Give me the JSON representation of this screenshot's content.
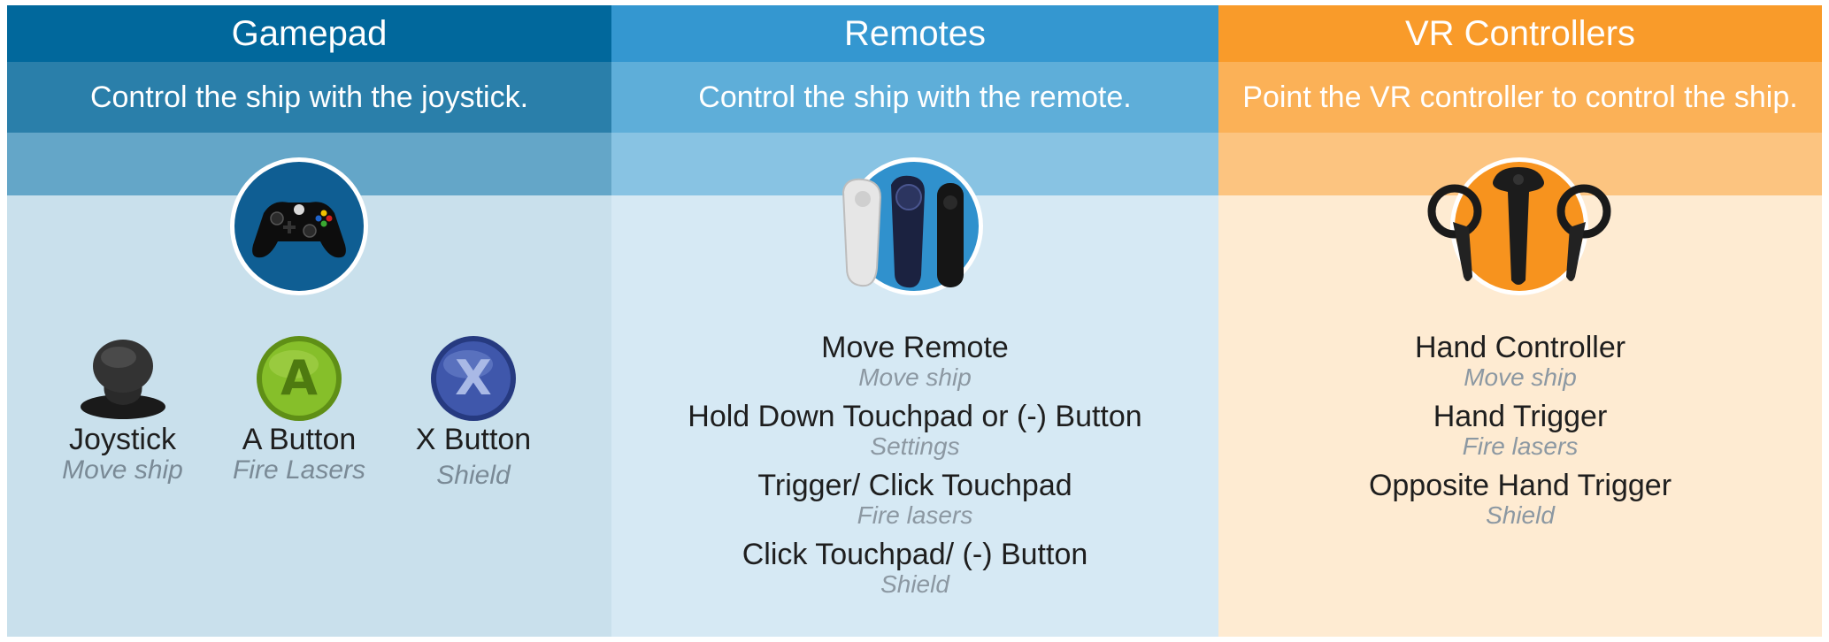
{
  "gamepad": {
    "title": "Gamepad",
    "subtitle": "Control the ship with the joystick.",
    "hero_icon": "xbox-controller-icon",
    "buttons": [
      {
        "name": "Joystick",
        "desc": "Move ship",
        "icon": "joystick-icon"
      },
      {
        "name": "A Button",
        "desc": "Fire Lasers",
        "icon": "a-button-icon",
        "letter": "A",
        "color": "#7ab51d"
      },
      {
        "name": "X Button",
        "desc": "Shield",
        "icon": "x-button-icon",
        "letter": "X",
        "color": "#3a4fa0"
      }
    ]
  },
  "remotes": {
    "title": "Remotes",
    "subtitle": "Control the ship with the remote.",
    "hero_icon": "vr-remotes-icon",
    "items": [
      {
        "name": "Move Remote",
        "desc": "Move ship"
      },
      {
        "name": "Hold Down Touchpad or (-) Button",
        "desc": "Settings"
      },
      {
        "name": "Trigger/ Click Touchpad",
        "desc": "Fire lasers"
      },
      {
        "name": "Click Touchpad/ (-) Button",
        "desc": "Shield"
      }
    ]
  },
  "vr": {
    "title": "VR Controllers",
    "subtitle": "Point the VR controller to control the ship.",
    "hero_icon": "vr-hand-controllers-icon",
    "items": [
      {
        "name": "Hand Controller",
        "desc": "Move ship"
      },
      {
        "name": "Hand Trigger",
        "desc": "Fire lasers"
      },
      {
        "name": "Opposite Hand Trigger",
        "desc": "Shield"
      }
    ]
  },
  "colors": {
    "gamepad_accent": "#01689c",
    "remotes_accent": "#3497d0",
    "vr_accent": "#f99b2a"
  }
}
